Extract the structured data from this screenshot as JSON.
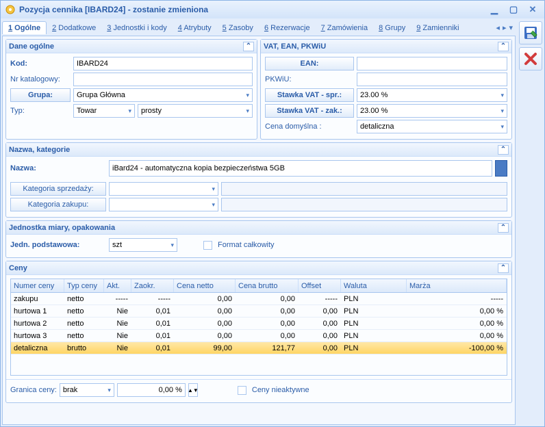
{
  "title": "Pozycja cennika [IBARD24] - zostanie zmieniona",
  "tabs": [
    "1 Ogólne",
    "2 Dodatkowe",
    "3 Jednostki i kody",
    "4 Atrybuty",
    "5 Zasoby",
    "6 Rezerwacje",
    "7 Zamówienia",
    "8 Grupy",
    "9 Zamienniki"
  ],
  "dane": {
    "hdr": "Dane ogólne",
    "kod_lbl": "Kod:",
    "kod": "IBARD24",
    "nkat_lbl": "Nr katalogowy:",
    "nkat": "",
    "grupa_btn": "Grupa:",
    "grupa": "Grupa Główna",
    "typ_lbl": "Typ:",
    "typ1": "Towar",
    "typ2": "prosty"
  },
  "vat": {
    "hdr": "VAT, EAN, PKWiU",
    "ean_btn": "EAN:",
    "ean": "",
    "pkwiu_lbl": "PKWiU:",
    "pkwiu": "",
    "spr_lbl": "Stawka VAT - spr.:",
    "spr": "23.00 %",
    "zak_lbl": "Stawka VAT - zak.:",
    "zak": "23.00 %",
    "dom_lbl": "Cena domyślna :",
    "dom": "detaliczna"
  },
  "naz": {
    "hdr": "Nazwa, kategorie",
    "nazwa_lbl": "Nazwa:",
    "nazwa": "iBard24 - automatyczna kopia bezpieczeństwa 5GB",
    "kspr_btn": "Kategoria sprzedaży:",
    "kspr": "",
    "kzak_btn": "Kategoria zakupu:",
    "kzak": ""
  },
  "jedn": {
    "hdr": "Jednostka miary, opakowania",
    "lbl": "Jedn. podstawowa:",
    "val": "szt",
    "format_lbl": "Format całkowity"
  },
  "ceny": {
    "hdr": "Ceny",
    "cols": [
      "Numer ceny",
      "Typ ceny",
      "Akt.",
      "Zaokr.",
      "Cena netto",
      "Cena brutto",
      "Offset",
      "Waluta",
      "Marża"
    ],
    "rows": [
      {
        "num": "zakupu",
        "typ": "netto",
        "akt": "-----",
        "zak": "-----",
        "net": "0,00",
        "bru": "0,00",
        "off": "-----",
        "wal": "PLN",
        "mar": "-----",
        "sel": false
      },
      {
        "num": "hurtowa 1",
        "typ": "netto",
        "akt": "Nie",
        "zak": "0,01",
        "net": "0,00",
        "bru": "0,00",
        "off": "0,00",
        "wal": "PLN",
        "mar": "0,00 %",
        "sel": false
      },
      {
        "num": "hurtowa 2",
        "typ": "netto",
        "akt": "Nie",
        "zak": "0,01",
        "net": "0,00",
        "bru": "0,00",
        "off": "0,00",
        "wal": "PLN",
        "mar": "0,00 %",
        "sel": false
      },
      {
        "num": "hurtowa 3",
        "typ": "netto",
        "akt": "Nie",
        "zak": "0,01",
        "net": "0,00",
        "bru": "0,00",
        "off": "0,00",
        "wal": "PLN",
        "mar": "0,00 %",
        "sel": false
      },
      {
        "num": "detaliczna",
        "typ": "brutto",
        "akt": "Nie",
        "zak": "0,01",
        "net": "99,00",
        "bru": "121,77",
        "off": "0,00",
        "wal": "PLN",
        "mar": "-100,00 %",
        "sel": true
      }
    ],
    "granica_lbl": "Granica ceny:",
    "granica_val": "brak",
    "granica_pct": "0,00 %",
    "nieakt_lbl": "Ceny nieaktywne"
  }
}
